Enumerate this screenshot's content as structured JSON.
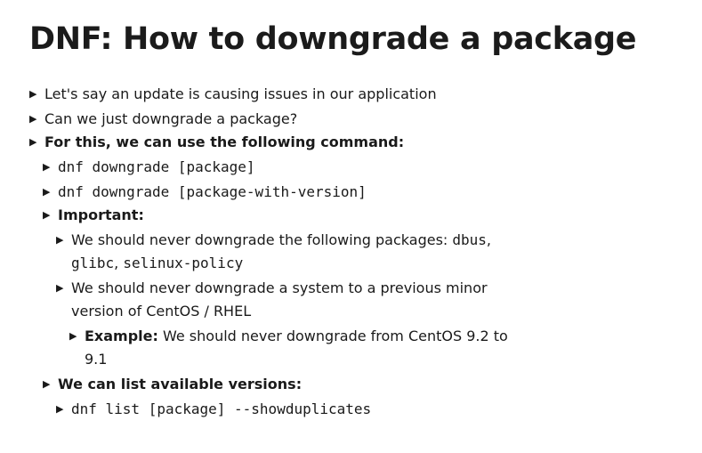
{
  "title": "DNF: How to downgrade a package",
  "bullets": {
    "b1": "Let's say an update is causing issues in our application",
    "b2": "Can we just downgrade a package?",
    "b3": "For this, we can use the following command:",
    "b3_1": "dnf downgrade [package]",
    "b3_2": "dnf downgrade [package-with-version]",
    "b3_3": "Important:",
    "b3_3_1_prefix": "We should never downgrade the following packages: ",
    "b3_3_1_code1": "dbus",
    "b3_3_1_sep1": ",",
    "b3_3_1_code2": "glibc",
    "b3_3_1_sep2": ", ",
    "b3_3_1_code3": "selinux-policy",
    "b3_3_2_line1": "We should never downgrade a system to a previous minor",
    "b3_3_2_line2": "version of CentOS / RHEL",
    "b3_3_2_1_label": "Example:",
    "b3_3_2_1_line1": " We should never downgrade from CentOS 9.2 to",
    "b3_3_2_1_line2": "9.1",
    "b3_4": "We can list available versions:",
    "b3_4_1": "dnf list [package] --showduplicates"
  },
  "marker_glyph": "▶"
}
